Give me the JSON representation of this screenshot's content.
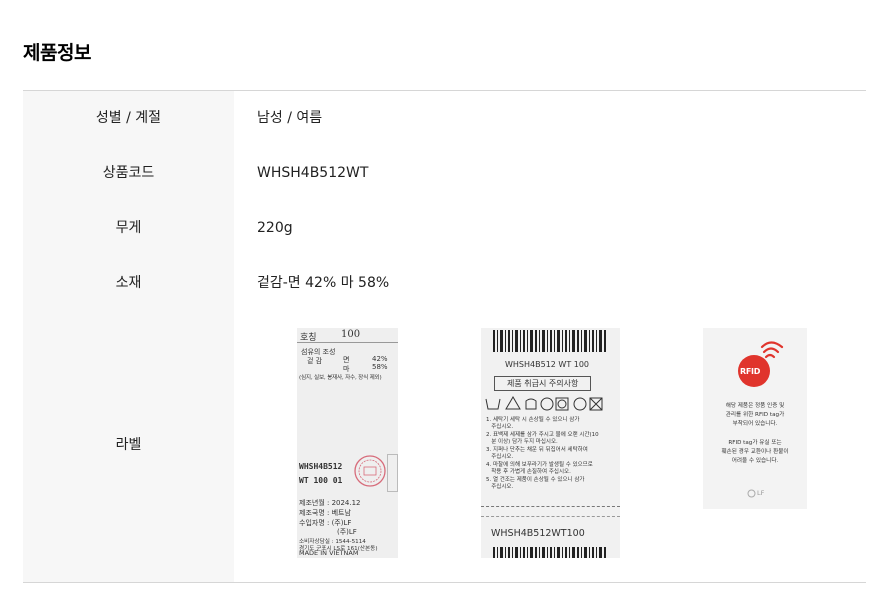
{
  "section_title": "제품정보",
  "rows": [
    {
      "key": "성별 / 계절",
      "value": "남성 / 여름"
    },
    {
      "key": "상품코드",
      "value": "WHSH4B512WT"
    },
    {
      "key": "무게",
      "value": "220g"
    },
    {
      "key": "소재",
      "value": "겉감-면 42% 마 58%"
    }
  ],
  "label_row_key": "라벨",
  "tag1": {
    "size_label": "호칭",
    "size_value": "100",
    "composition_title": "섬유의 조성",
    "shell": "겉 감",
    "cotton": "면",
    "cotton_pct": "42%",
    "linen": "마",
    "linen_pct": "58%",
    "exclusions": "(심지, 실보, 봉재사, 자수, 장식 제외)",
    "code": "WHSH4B512",
    "code2": "WT 100 01",
    "made_date": "제조년월 : 2024.12",
    "country": "제조국명 : 베트남",
    "importer": "수입자명 : (주)LF",
    "maker": "(주)LF",
    "consumer": "소비자상담실 : 1544-5114",
    "address": "경기도 군포시 LS로 161(산본동)",
    "origin": "MADE IN VIETNAM"
  },
  "tag2": {
    "code_top": "WHSH4B512 WT 100",
    "care_title": "제품 취급시 주의사항",
    "notes": [
      "1. 세탁기 세탁 시 손상될 수 있으니 삼가",
      "   주십시오.",
      "2. 표백제 세제를 삼가 주시고 물에 오랜 시간(10",
      "   분 이상) 담가 두지 마십시오.",
      "3. 지퍼나 단추는 채운 뒤 뒤집어서 세탁하여",
      "   주십시오.",
      "4. 마찰에 의해 보푸라기가 발생될 수 있으므로",
      "   착용 후 가볍게 손질하여 주십시오.",
      "5. 열 건조는 제품이 손상될 수 있으니 삼가",
      "   주십시오."
    ],
    "code_bottom": "WHSH4B512WT100"
  },
  "tag3": {
    "logo_text": "RFID",
    "line1": "해당 제품은 정품 인증 및",
    "line2": "관리를 위한 RFID tag가",
    "line3": "부착되어 있습니다.",
    "line4": "RFID tag가 유실 또는",
    "line5": "훼손된 경우 교환이나 환불이",
    "line6": "어려울 수 있습니다.",
    "brand": "LF"
  },
  "colors": {
    "rfid_red": "#e0342c",
    "label_bg": "#f7f7f7",
    "border": "#d6d6d6"
  }
}
